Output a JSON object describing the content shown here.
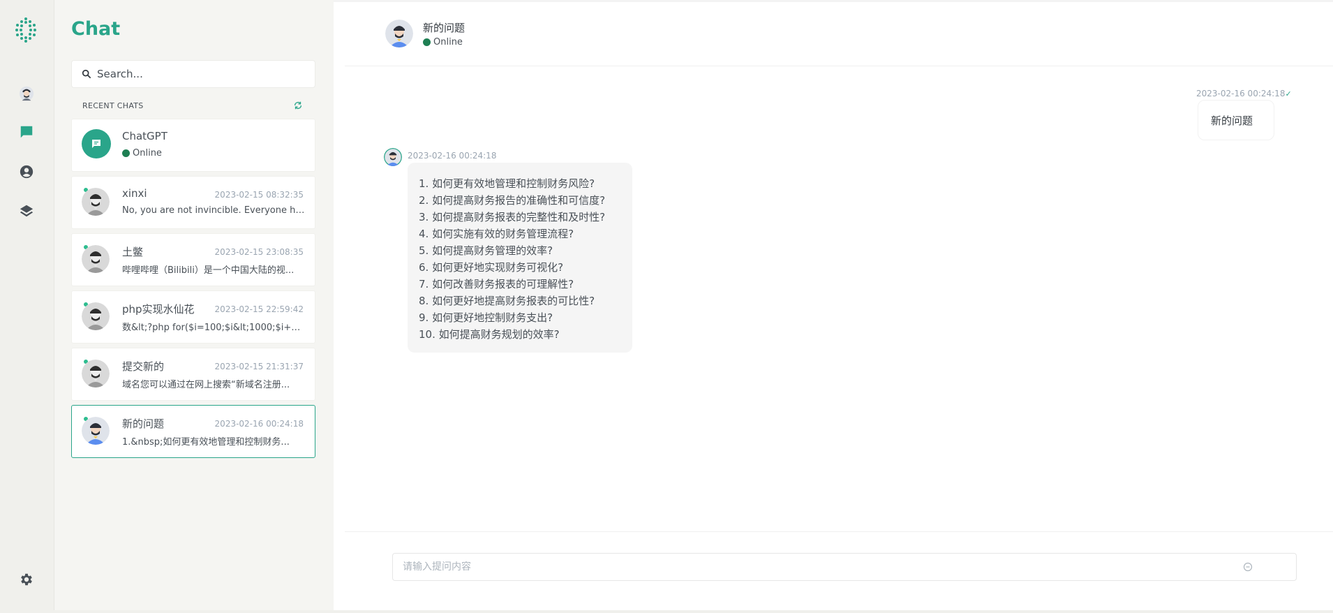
{
  "app": {
    "title": "Chat",
    "accent_color": "#2aa58a"
  },
  "rail": {
    "items": [
      {
        "icon": "avatar-icon"
      },
      {
        "icon": "chat-icon",
        "active": true
      },
      {
        "icon": "user-circle-icon"
      },
      {
        "icon": "layers-icon"
      }
    ],
    "settings_icon": "gear-icon"
  },
  "sidebar": {
    "search_placeholder": "Search...",
    "recent_label": "RECENT CHATS",
    "chats": [
      {
        "name": "ChatGPT",
        "status": "Online"
      },
      {
        "name": "xinxi",
        "time": "2023-02-15 08:32:35",
        "preview": "No, you are not invincible. Everyone has..."
      },
      {
        "name": "土鳖",
        "time": "2023-02-15 23:08:35",
        "preview": "哔哩哔哩（Bilibili）是一个中国大陆的视..."
      },
      {
        "name": "php实现水仙花",
        "time": "2023-02-15 22:59:42",
        "preview": "数&lt;?php for($i=100;$i&lt;1000;$i++)..."
      },
      {
        "name": "提交新的",
        "time": "2023-02-15 21:31:37",
        "preview": "域名您可以通过在网上搜索“新域名注册..."
      },
      {
        "name": "新的问题",
        "time": "2023-02-16 00:24:18",
        "preview": "1.&nbsp;如何更有效地管理和控制财务...",
        "active": true
      }
    ]
  },
  "conversation": {
    "header": {
      "name": "新的问题",
      "status": "Online"
    },
    "messages": [
      {
        "side": "right",
        "time": "2023-02-16 00:24:18",
        "text": "新的问题"
      },
      {
        "side": "left",
        "time": "2023-02-16 00:24:18",
        "lines": [
          "1. 如何更有效地管理和控制财务风险?",
          "2. 如何提高财务报告的准确性和可信度?",
          "3. 如何提高财务报表的完整性和及时性?",
          "4. 如何实施有效的财务管理流程?",
          "5. 如何提高财务管理的效率?",
          "6. 如何更好地实现财务可视化?",
          "7. 如何改善财务报表的可理解性?",
          "8. 如何更好地提高财务报表的可比性?",
          "9. 如何更好地控制财务支出?",
          "10. 如何提高财务规划的效率?"
        ]
      }
    ],
    "input_placeholder": "请输入提问内容"
  }
}
